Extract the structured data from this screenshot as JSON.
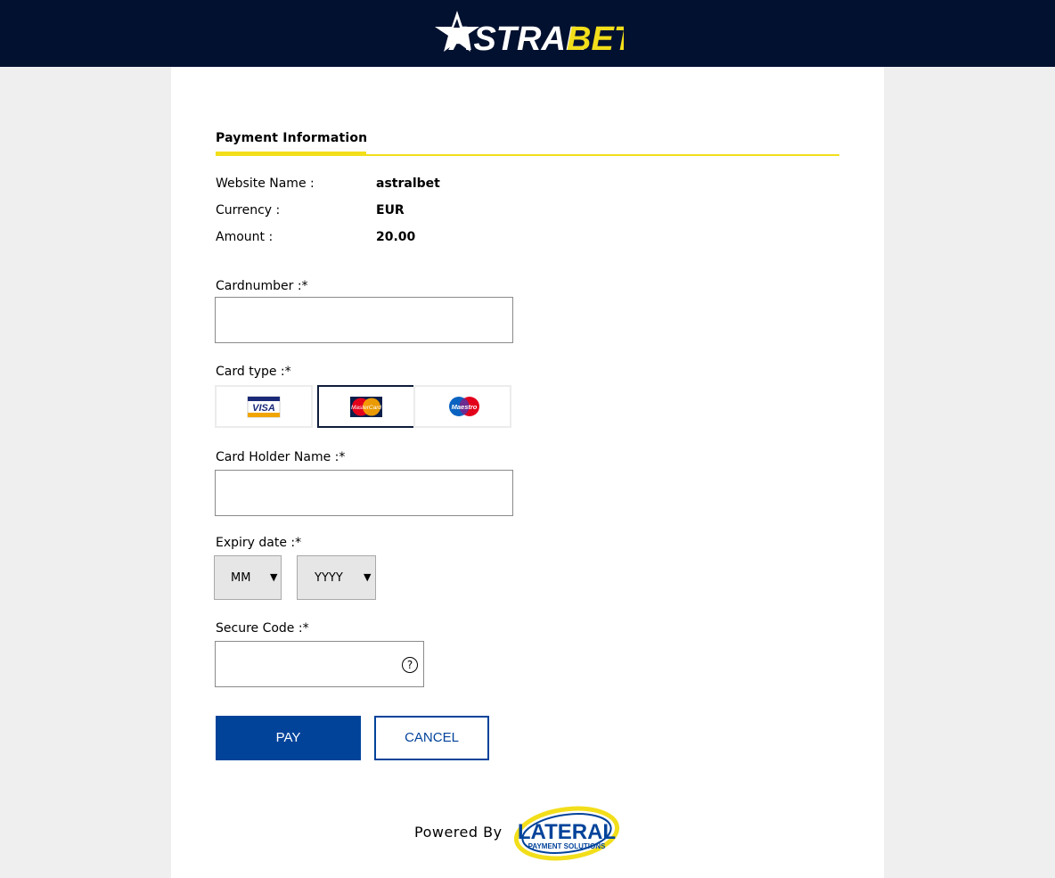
{
  "brand": {
    "name_white": "ASTRAL",
    "name_yellow": "BET"
  },
  "section": {
    "title": "Payment Information"
  },
  "info": [
    {
      "label": "Website Name :",
      "value": "astralbet"
    },
    {
      "label": "Currency :",
      "value": "EUR"
    },
    {
      "label": "Amount :",
      "value": "20.00"
    }
  ],
  "form": {
    "cardnumber_label": "Cardnumber :*",
    "cardnumber_value": "",
    "cardtype_label": "Card type :*",
    "card_types": [
      {
        "name": "VISA",
        "selected": false
      },
      {
        "name": "MasterCard",
        "selected": true
      },
      {
        "name": "Maestro",
        "selected": false
      }
    ],
    "holder_label": "Card Holder Name :*",
    "holder_value": "",
    "expiry_label": "Expiry date :*",
    "expiry_month": "MM",
    "expiry_year": "YYYY",
    "secure_label": "Secure Code :*",
    "secure_value": "",
    "help_glyph": "?"
  },
  "buttons": {
    "pay": "PAY",
    "cancel": "CANCEL"
  },
  "footer": {
    "powered_by": "Powered By",
    "provider_name": "LATERAL",
    "provider_tagline": "PAYMENT SOLUTIONS"
  },
  "colors": {
    "header_bg": "#031130",
    "accent_yellow": "#f2de1a",
    "primary_blue": "#02439a"
  }
}
